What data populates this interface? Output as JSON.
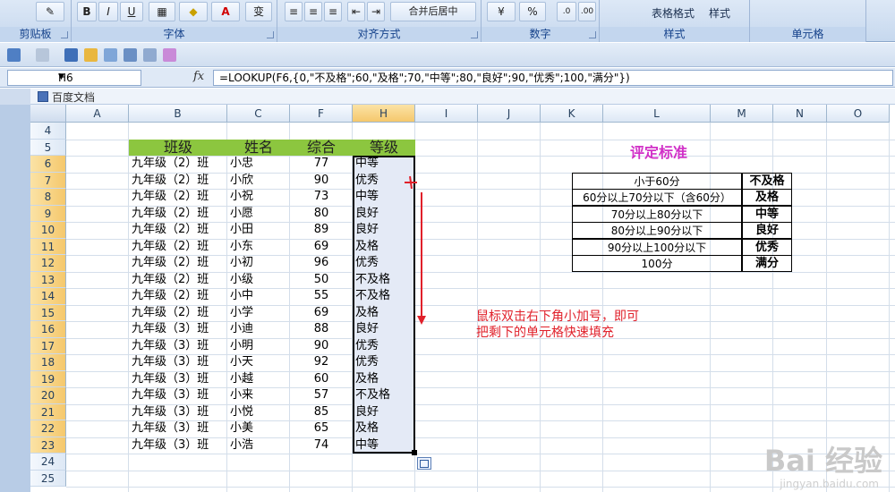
{
  "ribbon": {
    "groups": [
      "剪贴板",
      "字体",
      "对齐方式",
      "数字",
      "样式",
      "单元格"
    ],
    "merge_center": "合并后居中",
    "percent": "%",
    "table_format": "表格格式",
    "styles": "样式",
    "bold": "B",
    "italic": "I",
    "underline": "U",
    "font_color": "A",
    "wen": "变"
  },
  "formula_bar": {
    "name_box": "H6",
    "fx": "fx",
    "formula": "=LOOKUP(F6,{0,\"不及格\";60,\"及格\";70,\"中等\";80,\"良好\";90,\"优秀\";100,\"满分\"})"
  },
  "doc_tab": {
    "label": "百度文档"
  },
  "columns": [
    "A",
    "B",
    "C",
    "F",
    "H",
    "I",
    "J",
    "K",
    "L",
    "M",
    "N",
    "O"
  ],
  "rows": [
    "4",
    "5",
    "6",
    "7",
    "8",
    "9",
    "10",
    "11",
    "12",
    "13",
    "14",
    "15",
    "16",
    "17",
    "18",
    "19",
    "20",
    "21",
    "22",
    "23",
    "24",
    "25"
  ],
  "table": {
    "headers": {
      "class": "班级",
      "name": "姓名",
      "score": "综合",
      "grade": "等级"
    },
    "data": [
      {
        "class": "九年级（2）班",
        "name": "小忠",
        "score": "77",
        "grade": "中等"
      },
      {
        "class": "九年级（2）班",
        "name": "小欣",
        "score": "90",
        "grade": "优秀"
      },
      {
        "class": "九年级（2）班",
        "name": "小祝",
        "score": "73",
        "grade": "中等"
      },
      {
        "class": "九年级（2）班",
        "name": "小愿",
        "score": "80",
        "grade": "良好"
      },
      {
        "class": "九年级（2）班",
        "name": "小田",
        "score": "89",
        "grade": "良好"
      },
      {
        "class": "九年级（2）班",
        "name": "小东",
        "score": "69",
        "grade": "及格"
      },
      {
        "class": "九年级（2）班",
        "name": "小初",
        "score": "96",
        "grade": "优秀"
      },
      {
        "class": "九年级（2）班",
        "name": "小级",
        "score": "50",
        "grade": "不及格"
      },
      {
        "class": "九年级（2）班",
        "name": "小中",
        "score": "55",
        "grade": "不及格"
      },
      {
        "class": "九年级（2）班",
        "name": "小学",
        "score": "69",
        "grade": "及格"
      },
      {
        "class": "九年级（3）班",
        "name": "小迪",
        "score": "88",
        "grade": "良好"
      },
      {
        "class": "九年级（3）班",
        "name": "小明",
        "score": "90",
        "grade": "优秀"
      },
      {
        "class": "九年级（3）班",
        "name": "小天",
        "score": "92",
        "grade": "优秀"
      },
      {
        "class": "九年级（3）班",
        "name": "小越",
        "score": "60",
        "grade": "及格"
      },
      {
        "class": "九年级（3）班",
        "name": "小来",
        "score": "57",
        "grade": "不及格"
      },
      {
        "class": "九年级（3）班",
        "name": "小悦",
        "score": "85",
        "grade": "良好"
      },
      {
        "class": "九年级（3）班",
        "name": "小美",
        "score": "65",
        "grade": "及格"
      },
      {
        "class": "九年级（3）班",
        "name": "小浩",
        "score": "74",
        "grade": "中等"
      }
    ]
  },
  "standard": {
    "title": "评定标准",
    "rows": [
      {
        "condition": "小于60分",
        "grade": "不及格"
      },
      {
        "condition": "60分以上70分以下（含60分）",
        "grade": "及格"
      },
      {
        "condition": "70分以上80分以下",
        "grade": "中等"
      },
      {
        "condition": "80分以上90分以下",
        "grade": "良好"
      },
      {
        "condition": "90分以上100分以下",
        "grade": "优秀"
      },
      {
        "condition": "100分",
        "grade": "满分"
      }
    ]
  },
  "annotation": {
    "line1": "鼠标双击右下角小加号，即可",
    "line2": "把剩下的单元格快速填充"
  },
  "watermark": {
    "main": "Bai 经验",
    "sub": "jingyan.baidu.com"
  },
  "colors": {
    "header_green": "#8cc63f",
    "annotation_red": "#e0202a",
    "title_magenta": "#d12fc7"
  }
}
